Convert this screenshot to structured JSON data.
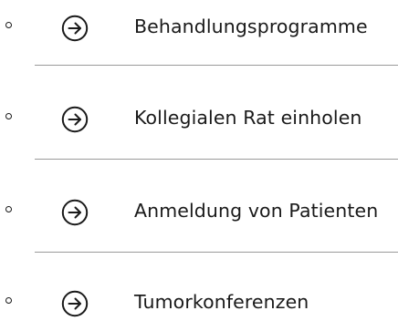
{
  "nav": {
    "items": [
      {
        "label": "Behandlungsprogramme",
        "icon": "arrow-right-circle-icon"
      },
      {
        "label": "Kollegialen Rat einholen",
        "icon": "arrow-right-circle-icon"
      },
      {
        "label": "Anmeldung von Patienten",
        "icon": "arrow-right-circle-icon"
      },
      {
        "label": "Tumorkonferenzen",
        "icon": "arrow-right-circle-icon"
      }
    ]
  },
  "colors": {
    "text": "#1a1a1a",
    "divider": "#9a9a9a"
  }
}
